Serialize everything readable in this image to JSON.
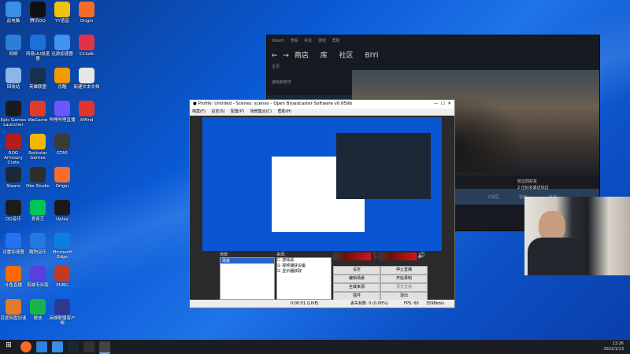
{
  "desktop_icons": [
    {
      "label": "此电脑",
      "color": "#3a8ee6",
      "col": 0,
      "row": 0
    },
    {
      "label": "网络",
      "color": "#2a7fd6",
      "col": 0,
      "row": 1
    },
    {
      "label": "回收站",
      "color": "#8ab6e8",
      "col": 0,
      "row": 2
    },
    {
      "label": "Epic Games Launcher",
      "color": "#1b1b1b",
      "col": 0,
      "row": 3
    },
    {
      "label": "ROG Armoury Crate",
      "color": "#b41d1d",
      "col": 0,
      "row": 4
    },
    {
      "label": "Steam",
      "color": "#1b2838",
      "col": 0,
      "row": 5
    },
    {
      "label": "QQ音乐",
      "color": "#1c1c1c",
      "col": 0,
      "row": 6
    },
    {
      "label": "迅雷加速器",
      "color": "#2472f0",
      "col": 0,
      "row": 7
    },
    {
      "label": "斗鱼直播",
      "color": "#ff6a00",
      "col": 0,
      "row": 8
    },
    {
      "label": "百度网盘加速",
      "color": "#e07b2b",
      "col": 0,
      "row": 9
    },
    {
      "label": "腾讯QQ",
      "color": "#111111",
      "col": 1,
      "row": 0
    },
    {
      "label": "网易UU加速器",
      "color": "#1d6fd9",
      "col": 1,
      "row": 1
    },
    {
      "label": "英雄联盟",
      "color": "#16324e",
      "col": 1,
      "row": 2
    },
    {
      "label": "WeGame",
      "color": "#e33b2b",
      "col": 1,
      "row": 3
    },
    {
      "label": "Rockstar Games",
      "color": "#f5b800",
      "col": 1,
      "row": 4
    },
    {
      "label": "Obs Studio",
      "color": "#2e2e2e",
      "col": 1,
      "row": 5
    },
    {
      "label": "爱奇艺",
      "color": "#00c656",
      "col": 1,
      "row": 6
    },
    {
      "label": "酷狗音乐",
      "color": "#2477e0",
      "col": 1,
      "row": 7
    },
    {
      "label": "剪映专业版",
      "color": "#5a3ee0",
      "col": 1,
      "row": 8
    },
    {
      "label": "微信",
      "color": "#19b34c",
      "col": 1,
      "row": 9
    },
    {
      "label": "YY语音",
      "color": "#f2c10e",
      "col": 2,
      "row": 0
    },
    {
      "label": "迅游加速器",
      "color": "#3f92f0",
      "col": 2,
      "row": 1
    },
    {
      "label": "优酷",
      "color": "#f29a00",
      "col": 2,
      "row": 2
    },
    {
      "label": "哔哩哔哩直播",
      "color": "#6c56ff",
      "col": 2,
      "row": 3
    },
    {
      "label": "GTA5",
      "color": "#3b3b3b",
      "col": 2,
      "row": 4
    },
    {
      "label": "Origin",
      "color": "#f56c2d",
      "col": 2,
      "row": 5
    },
    {
      "label": "Uplay",
      "color": "#1a1a1a",
      "col": 2,
      "row": 6
    },
    {
      "label": "Microsoft Edge",
      "color": "#0c7ee0",
      "col": 2,
      "row": 7
    },
    {
      "label": "PUBG",
      "color": "#c13a23",
      "col": 2,
      "row": 8
    },
    {
      "label": "英雄联盟客户端",
      "color": "#2d3a8e",
      "col": 2,
      "row": 9
    },
    {
      "label": "Origin",
      "color": "#f56b2a",
      "col": 3,
      "row": 0
    },
    {
      "label": "CCtalk",
      "color": "#e2324a",
      "col": 3,
      "row": 1
    },
    {
      "label": "新建文本文档",
      "color": "#e6e6e6",
      "col": 3,
      "row": 2
    },
    {
      "label": "XMind",
      "color": "#e3342b",
      "col": 3,
      "row": 3
    }
  ],
  "steam": {
    "menu": [
      "Steam",
      "查看",
      "好友",
      "游戏",
      "帮助"
    ],
    "nav": [
      "商店",
      "库",
      "社区",
      "BIYI"
    ],
    "home_label": "主页",
    "filter_label": "游戏和软件",
    "friend_panel_title": "2 位好友最近玩过",
    "recent_label": "玩过的好友",
    "tabs": [
      "商店页面",
      "社区中心",
      "讨论区",
      "指南",
      "支持"
    ]
  },
  "obs": {
    "title": "Profile: Untitled - Scenes: scenes - Open Broadcaster Software v0.659b",
    "menus": [
      "档案(F)",
      "设定(S)",
      "配置(P)",
      "场景集合(C)",
      "帮助(H)"
    ],
    "scenes_header": "场景:",
    "scenes": [
      "场景"
    ],
    "sources_header": "来源:",
    "sources": [
      {
        "label": "游戏源",
        "checked": false
      },
      {
        "label": "视频捕获设备",
        "checked": true
      },
      {
        "label": "显示器获取",
        "checked": true
      }
    ],
    "buttons": [
      "设定",
      "编辑场景",
      "全域来源",
      "插件"
    ],
    "right_buttons": [
      "停止直播",
      "开始录制",
      "预览直播",
      "退出"
    ],
    "status": {
      "time": "0:00:51 (LIVE)",
      "dropped": "丢失帧数: 0 (0.00%)",
      "fps": "FPS: 60",
      "kbps": "3598kb/s"
    }
  },
  "tray": {
    "time": "13:26",
    "date": "2022/1/13"
  }
}
